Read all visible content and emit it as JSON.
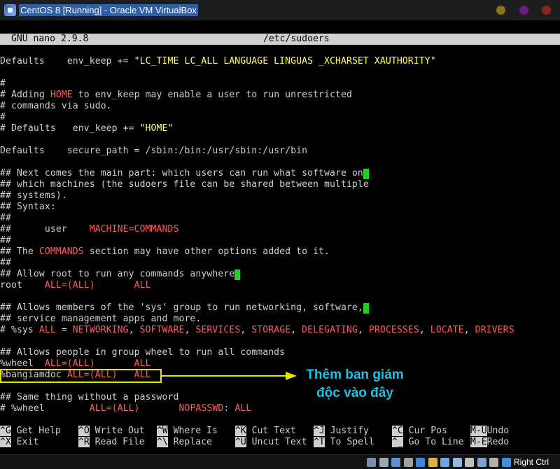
{
  "window": {
    "title": "CentOS 8 [Running] - Oracle VM VirtualBox"
  },
  "nano": {
    "version": "GNU nano 2.9.8",
    "filename": "/etc/sudoers"
  },
  "lines": [
    {
      "row": 0,
      "segs": [
        {
          "t": "Defaults    env_keep += "
        },
        {
          "t": "\"LC_TIME LC_ALL LANGUAGE LINGUAS _XCHARSET XAUTHORITY\"",
          "c": "y"
        }
      ]
    },
    {
      "row": 2,
      "segs": [
        {
          "t": "#"
        }
      ]
    },
    {
      "row": 3,
      "segs": [
        {
          "t": "# Adding "
        },
        {
          "t": "HOME",
          "c": "r"
        },
        {
          "t": " to env_keep may enable a user to run unrestricted"
        }
      ]
    },
    {
      "row": 4,
      "segs": [
        {
          "t": "# commands via sudo."
        }
      ]
    },
    {
      "row": 5,
      "segs": [
        {
          "t": "#"
        }
      ]
    },
    {
      "row": 6,
      "segs": [
        {
          "t": "# Defaults   env_keep += "
        },
        {
          "t": "\"HOME\"",
          "c": "y"
        }
      ]
    },
    {
      "row": 8,
      "segs": [
        {
          "t": "Defaults    secure_path = /sbin:/bin:/usr/sbin:/usr/bin"
        }
      ]
    },
    {
      "row": 10,
      "segs": [
        {
          "t": "## Next comes the main part: which users can run what software on"
        }
      ],
      "cursor": true
    },
    {
      "row": 11,
      "segs": [
        {
          "t": "## which machines (the sudoers file can be shared between multiple"
        }
      ]
    },
    {
      "row": 12,
      "segs": [
        {
          "t": "## systems)."
        }
      ]
    },
    {
      "row": 13,
      "segs": [
        {
          "t": "## Syntax:"
        }
      ]
    },
    {
      "row": 14,
      "segs": [
        {
          "t": "##"
        }
      ]
    },
    {
      "row": 15,
      "segs": [
        {
          "t": "##      user    "
        },
        {
          "t": "MACHINE=COMMANDS",
          "c": "r"
        }
      ]
    },
    {
      "row": 16,
      "segs": [
        {
          "t": "##"
        }
      ]
    },
    {
      "row": 17,
      "segs": [
        {
          "t": "## The "
        },
        {
          "t": "COMMANDS",
          "c": "r"
        },
        {
          "t": " section may have other options added to it."
        }
      ]
    },
    {
      "row": 18,
      "segs": [
        {
          "t": "##"
        }
      ]
    },
    {
      "row": 19,
      "segs": [
        {
          "t": "## Allow root to run any commands anywhere"
        }
      ],
      "cursor": true
    },
    {
      "row": 20,
      "segs": [
        {
          "t": "root    "
        },
        {
          "t": "ALL=(ALL)",
          "c": "r"
        },
        {
          "t": "       "
        },
        {
          "t": "ALL",
          "c": "r"
        }
      ]
    },
    {
      "row": 22,
      "segs": [
        {
          "t": "## Allows members of the 'sys' group to run networking, software,"
        }
      ],
      "cursor": true
    },
    {
      "row": 23,
      "segs": [
        {
          "t": "## service management apps and more."
        }
      ]
    },
    {
      "row": 24,
      "segs": [
        {
          "t": "# %sys "
        },
        {
          "t": "ALL",
          "c": "r"
        },
        {
          "t": " = "
        },
        {
          "t": "NETWORKING",
          "c": "r"
        },
        {
          "t": ", "
        },
        {
          "t": "SOFTWARE",
          "c": "r"
        },
        {
          "t": ", "
        },
        {
          "t": "SERVICES",
          "c": "r"
        },
        {
          "t": ", "
        },
        {
          "t": "STORAGE",
          "c": "r"
        },
        {
          "t": ", "
        },
        {
          "t": "DELEGATING",
          "c": "r"
        },
        {
          "t": ", "
        },
        {
          "t": "PROCESSES",
          "c": "r"
        },
        {
          "t": ", "
        },
        {
          "t": "LOCATE",
          "c": "r"
        },
        {
          "t": ", "
        },
        {
          "t": "DRIVERS",
          "c": "r"
        }
      ]
    },
    {
      "row": 26,
      "segs": [
        {
          "t": "## Allows people in group wheel to run all commands"
        }
      ]
    },
    {
      "row": 27,
      "segs": [
        {
          "t": "%wheel  "
        },
        {
          "t": "ALL=(ALL)",
          "c": "r"
        },
        {
          "t": "       "
        },
        {
          "t": "ALL",
          "c": "r"
        }
      ]
    },
    {
      "row": 28,
      "segs": [
        {
          "t": "%bangiamdoc "
        },
        {
          "t": "ALL=(ALL)",
          "c": "r"
        },
        {
          "t": "   "
        },
        {
          "t": "ALL",
          "c": "r"
        }
      ]
    },
    {
      "row": 30,
      "segs": [
        {
          "t": "## Same thing without a password"
        }
      ]
    },
    {
      "row": 31,
      "segs": [
        {
          "t": "# %wheel        "
        },
        {
          "t": "ALL=(ALL)",
          "c": "r"
        },
        {
          "t": "       "
        },
        {
          "t": "NOPASSWD",
          "c": "r"
        },
        {
          "t": ": "
        },
        {
          "t": "ALL",
          "c": "r"
        }
      ]
    }
  ],
  "shortcuts": [
    {
      "key": "^G",
      "label": "Get Help"
    },
    {
      "key": "^X",
      "label": "Exit"
    },
    {
      "key": "^O",
      "label": "Write Out"
    },
    {
      "key": "^R",
      "label": "Read File"
    },
    {
      "key": "^W",
      "label": "Where Is"
    },
    {
      "key": "^\\",
      "label": "Replace"
    },
    {
      "key": "^K",
      "label": "Cut Text"
    },
    {
      "key": "^U",
      "label": "Uncut Text"
    },
    {
      "key": "^J",
      "label": "Justify"
    },
    {
      "key": "^T",
      "label": "To Spell"
    },
    {
      "key": "^C",
      "label": "Cur Pos"
    },
    {
      "key": "^_",
      "label": "Go To Line"
    },
    {
      "key": "M-U",
      "label": "Undo"
    },
    {
      "key": "M-E",
      "label": "Redo"
    }
  ],
  "annotation": {
    "line1": "Thêm ban giám",
    "line2": "độc vào đây"
  },
  "statusbar": {
    "host_key": "Right Ctrl",
    "icons": [
      "hdd-icon",
      "optical-icon",
      "usb-icon",
      "audio-icon",
      "network-icon",
      "shared-folder-icon",
      "display-icon",
      "screen-icon",
      "recording-icon",
      "cpu-icon",
      "mouse-icon",
      "keyboard-icon"
    ]
  },
  "colors": {
    "keyword_red": "#ff5a5a",
    "string_yellow": "#ffff66",
    "cursor_green": "#19d619",
    "annotation_cyan": "#1ec0e6",
    "annotation_box_yellow": "#e5e500",
    "title_highlight": "#2d5fa8"
  }
}
